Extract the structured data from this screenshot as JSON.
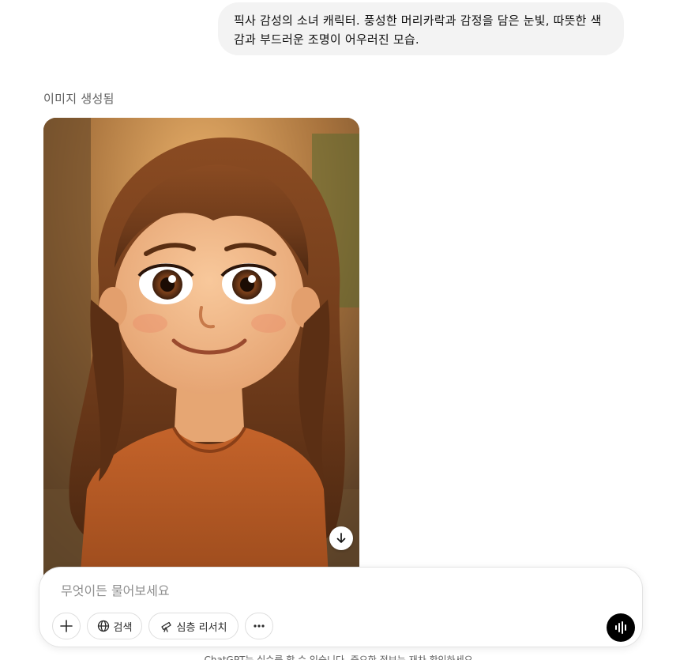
{
  "conversation": {
    "user_message": "픽사 감성의 소녀 캐릭터. 풍성한 머리카락과 감정을 담은 눈빛, 따뜻한 색감과 부드러운 조명이 어우러진 모습.",
    "status_label": "이미지 생성됨",
    "generated_image": {
      "subject": "smiling girl with long wavy brown hair in an orange t-shirt",
      "download_icon": "arrow-down-icon"
    }
  },
  "composer": {
    "placeholder": "무엇이든 물어보세요",
    "value": "",
    "add_icon": "plus-icon",
    "search_label": "검색",
    "search_icon": "globe-icon",
    "research_label": "심층 리서치",
    "research_icon": "telescope-icon",
    "more_icon": "ellipsis-icon",
    "voice_icon": "voice-wave-icon"
  },
  "footer": {
    "note": "ChatGPT는 실수를 할 수 있습니다. 중요한 정보는 재차 확인하세요."
  },
  "colors": {
    "bubble_bg": "#f3f3f3",
    "voice_button_bg": "#000000",
    "secondary_text": "#5d5d5d"
  }
}
